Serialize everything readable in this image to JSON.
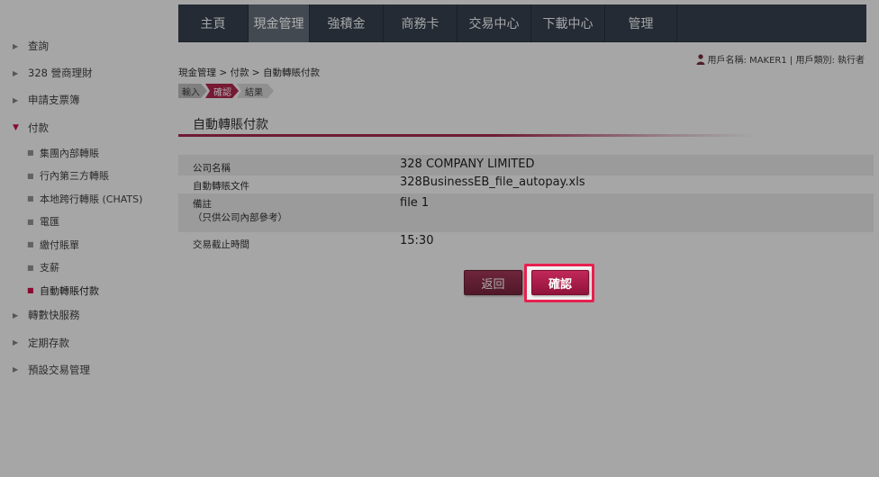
{
  "sidebar": {
    "items_before": [
      {
        "label": "查詢"
      },
      {
        "label": "328 營商理財"
      },
      {
        "label": "申請支票簿"
      }
    ],
    "open_item": {
      "label": "付款"
    },
    "sub_items": [
      {
        "label": "集團內部轉賬"
      },
      {
        "label": "行內第三方轉賬"
      },
      {
        "label": "本地跨行轉賬 (CHATS)"
      },
      {
        "label": "電匯"
      },
      {
        "label": "繳付賬單"
      },
      {
        "label": "支薪"
      },
      {
        "label": "自動轉賬付款"
      }
    ],
    "active_sub_index": 6,
    "items_after": [
      {
        "label": "轉數快服務"
      },
      {
        "label": "定期存款"
      },
      {
        "label": "預設交易管理"
      }
    ]
  },
  "nav": {
    "tabs": [
      {
        "label": "主頁"
      },
      {
        "label": "現金管理"
      },
      {
        "label": "強積金"
      },
      {
        "label": "商務卡"
      },
      {
        "label": "交易中心"
      },
      {
        "label": "下載中心"
      },
      {
        "label": "管理"
      }
    ],
    "active_index": 1
  },
  "user": {
    "text": "用戶名稱: MAKER1 | 用戶類別: 執行者"
  },
  "breadcrumb": "現金管理 > 付款 > 自動轉賬付款",
  "steps": [
    {
      "label": "輸入"
    },
    {
      "label": "確認"
    },
    {
      "label": "結果"
    }
  ],
  "section": {
    "title": "自動轉賬付款"
  },
  "form": {
    "company_label": "公司名稱",
    "company_value": "328 COMPANY LIMITED",
    "file_label": "自動轉賬文件",
    "file_value": "328BusinessEB_file_autopay.xls",
    "remark_label": "備註",
    "remark_sublabel": "（只供公司內部參考）",
    "remark_value": "file 1",
    "cutoff_label": "交易截止時間",
    "cutoff_value": "15:30"
  },
  "buttons": {
    "back": "返回",
    "confirm": "確認"
  },
  "colors": {
    "nav_bg": "#2a3340",
    "accent": "#a8173f",
    "highlight": "#e8204f"
  }
}
